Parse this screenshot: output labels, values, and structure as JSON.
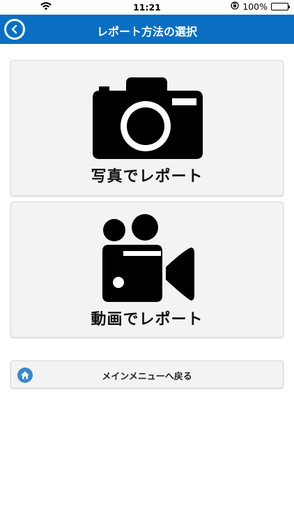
{
  "status_bar": {
    "time": "11:21",
    "battery_percent": "100%",
    "icons": [
      "wifi-icon",
      "orientation-lock-icon",
      "battery-icon"
    ]
  },
  "navbar": {
    "title": "レポート方法の選択",
    "back_icon": "chevron-left-icon",
    "color": "#0a6fc2"
  },
  "options": {
    "photo": {
      "label": "写真でレポート",
      "icon": "camera-icon"
    },
    "video": {
      "label": "動画でレポート",
      "icon": "video-camera-icon"
    }
  },
  "main_menu": {
    "label": "メインメニューへ戻る",
    "icon": "home-icon"
  }
}
